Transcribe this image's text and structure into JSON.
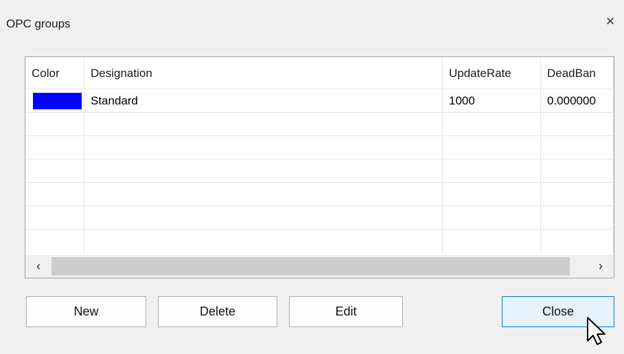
{
  "dialog": {
    "title": "OPC groups",
    "close_glyph": "×"
  },
  "grid": {
    "columns": [
      "Color",
      "Designation",
      "UpdateRate",
      "DeadBan"
    ],
    "rows": [
      {
        "color": "#0000ff",
        "designation": "Standard",
        "update_rate": "1000",
        "dead_band": "0.000000"
      }
    ]
  },
  "scrollbar": {
    "left_arrow": "‹",
    "right_arrow": "›"
  },
  "buttons": {
    "new": "New",
    "delete": "Delete",
    "edit": "Edit",
    "close": "Close"
  },
  "colors": {
    "window_bg": "#f0f0f0",
    "accent": "#0078d7",
    "selected_button_bg": "#e5f1fb"
  },
  "icons": {
    "cursor": "mouse-pointer-icon"
  }
}
